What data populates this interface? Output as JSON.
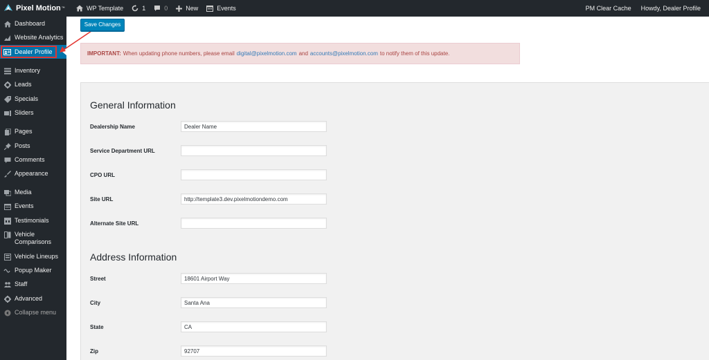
{
  "adminbar": {
    "brand": "Pixel Motion",
    "brand_tm": "™",
    "site_name": "WP Template",
    "updates_count": "1",
    "comments_count": "0",
    "new_label": "New",
    "events_label": "Events",
    "clear_cache": "PM Clear Cache",
    "howdy": "Howdy, Dealer Profile"
  },
  "sidebar": {
    "items": [
      {
        "label": "Dashboard",
        "icon": "dashboard-icon"
      },
      {
        "label": "Website Analytics",
        "icon": "analytics-icon"
      },
      {
        "label": "Dealer Profile",
        "icon": "id-card-icon"
      },
      {
        "label": "Inventory",
        "icon": "list-icon"
      },
      {
        "label": "Leads",
        "icon": "gear-icon"
      },
      {
        "label": "Specials",
        "icon": "tag-icon"
      },
      {
        "label": "Sliders",
        "icon": "sliders-icon"
      },
      {
        "label": "Pages",
        "icon": "pages-icon"
      },
      {
        "label": "Posts",
        "icon": "pin-icon"
      },
      {
        "label": "Comments",
        "icon": "comment-icon"
      },
      {
        "label": "Appearance",
        "icon": "brush-icon"
      },
      {
        "label": "Media",
        "icon": "media-icon"
      },
      {
        "label": "Events",
        "icon": "calendar-icon"
      },
      {
        "label": "Testimonials",
        "icon": "quote-icon"
      },
      {
        "label": "Vehicle",
        "label2": "Comparisons",
        "icon": "compare-icon"
      },
      {
        "label": "Vehicle Lineups",
        "icon": "lineup-icon"
      },
      {
        "label": "Popup Maker",
        "icon": "popup-icon"
      },
      {
        "label": "Staff",
        "icon": "staff-icon"
      },
      {
        "label": "Advanced",
        "icon": "gear-icon"
      },
      {
        "label": "Collapse menu",
        "icon": "collapse-icon"
      }
    ]
  },
  "toolbar": {
    "save_label": "Save Changes"
  },
  "notice": {
    "strong": "IMPORTANT:",
    "text1": "When updating phone numbers, please email",
    "email1": "digital@pixelmotion.com",
    "and": "and",
    "email2": "accounts@pixelmotion.com",
    "text2": "to notify them of this update."
  },
  "general": {
    "title": "General Information",
    "fields": [
      {
        "label": "Dealership Name",
        "value": "Dealer Name"
      },
      {
        "label": "Service Department URL",
        "value": ""
      },
      {
        "label": "CPO URL",
        "value": ""
      },
      {
        "label": "Site URL",
        "value": "http://template3.dev.pixelmotiondemo.com"
      },
      {
        "label": "Alternate Site URL",
        "value": ""
      }
    ]
  },
  "address": {
    "title": "Address Information",
    "fields": [
      {
        "label": "Street",
        "value": "18601 Airport Way"
      },
      {
        "label": "City",
        "value": "Santa Ana"
      },
      {
        "label": "State",
        "value": "CA"
      },
      {
        "label": "Zip",
        "value": "92707"
      }
    ]
  },
  "colors": {
    "accent": "#0073aa",
    "button": "#0085ba",
    "highlight": "#e3342f",
    "notice_bg": "#f2dede"
  }
}
